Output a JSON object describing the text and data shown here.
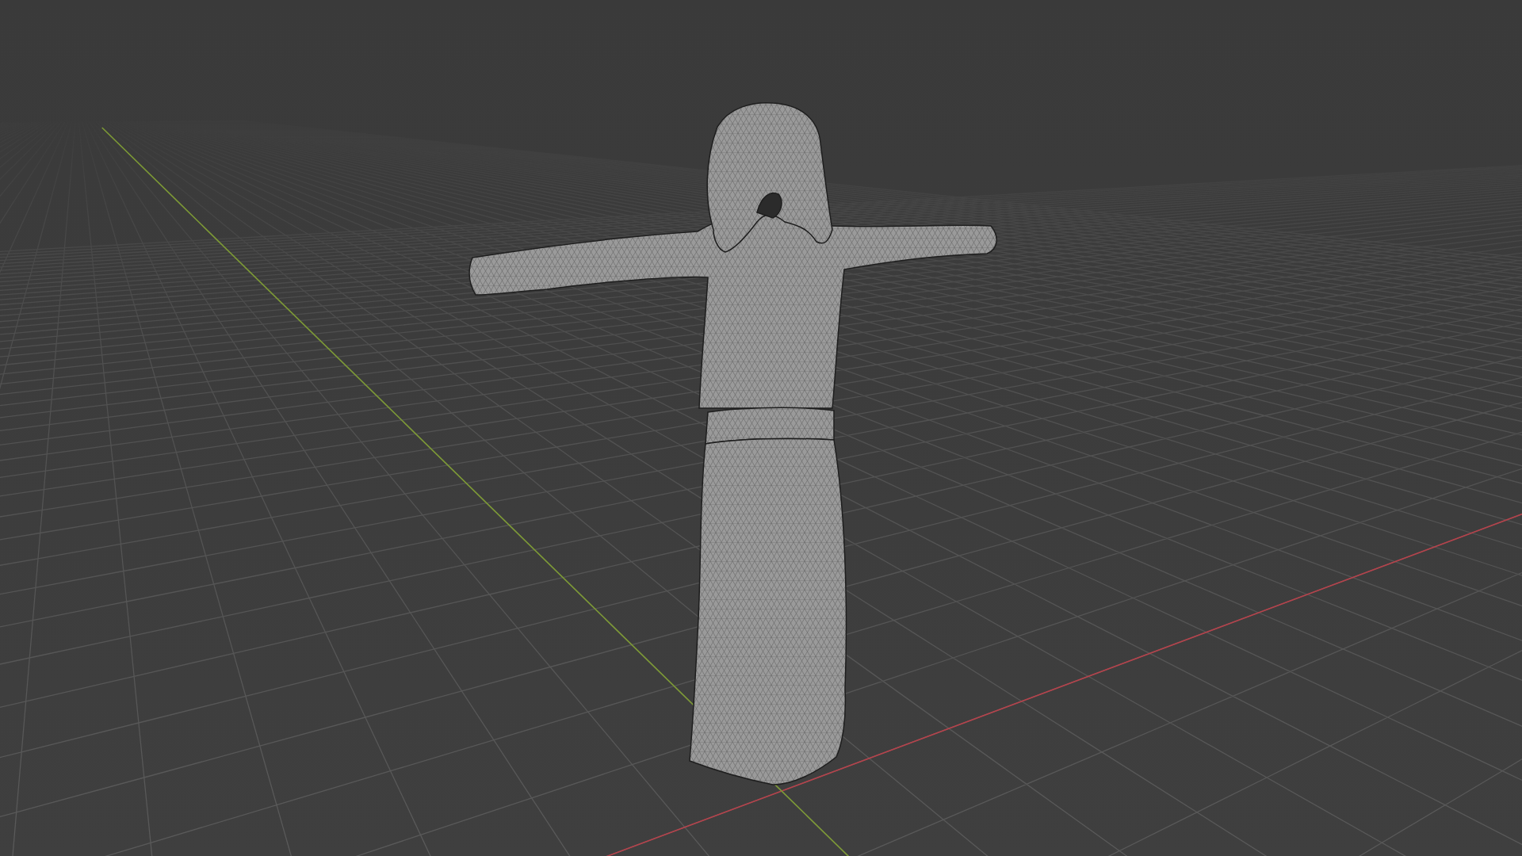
{
  "viewport": {
    "floor_grid": true,
    "axes": [
      {
        "kind": "x",
        "color": "#b5434c"
      },
      {
        "kind": "y",
        "color": "#7d9a35"
      }
    ],
    "model": {
      "kind": "mesh",
      "wireframe": true
    }
  }
}
